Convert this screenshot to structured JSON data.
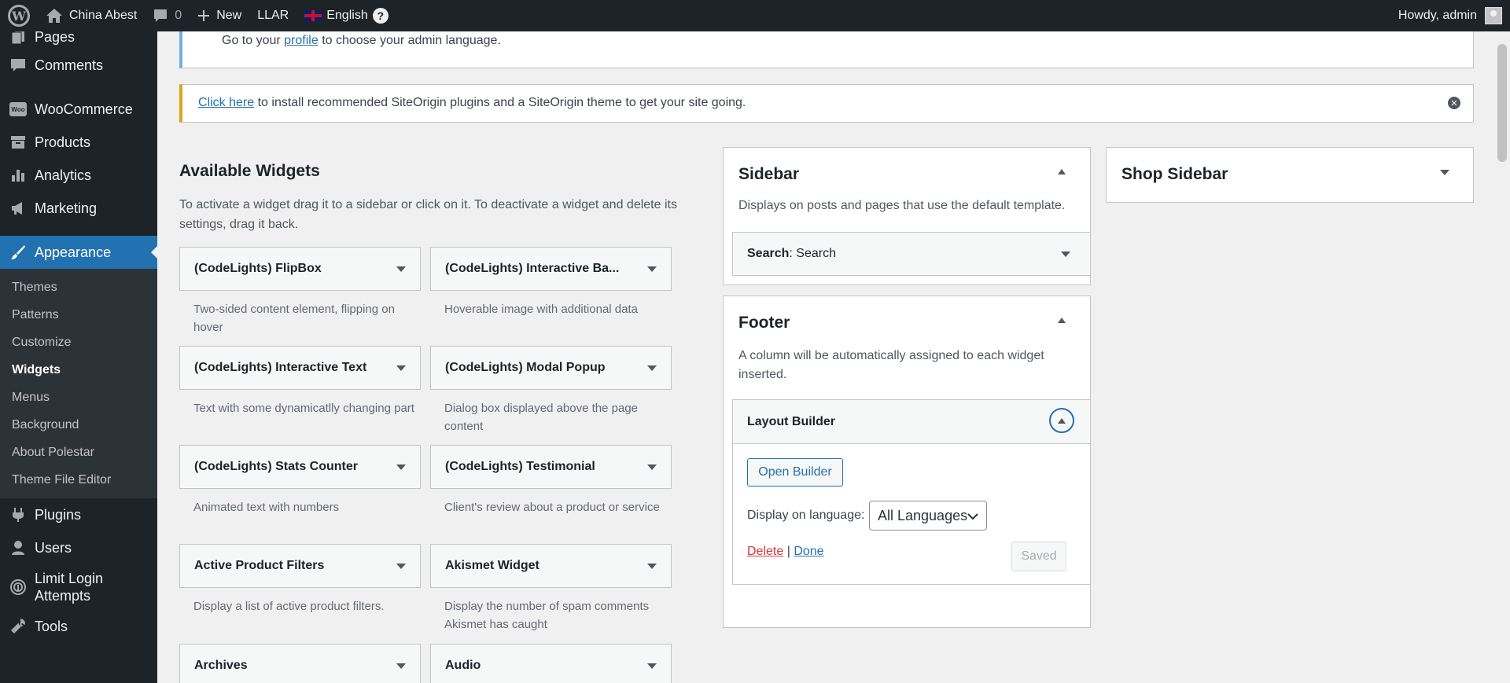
{
  "adminbar": {
    "site_name": "China Abest",
    "comments_count": "0",
    "new_label": "New",
    "llar_label": "LLAR",
    "language_label": "English",
    "help_label": "?",
    "howdy": "Howdy, admin"
  },
  "menu": {
    "pages": "Pages",
    "comments": "Comments",
    "woocommerce": "WooCommerce",
    "woo_badge": "Woo",
    "products": "Products",
    "analytics": "Analytics",
    "marketing": "Marketing",
    "appearance": "Appearance",
    "sub": [
      "Themes",
      "Patterns",
      "Customize",
      "Widgets",
      "Menus",
      "Background",
      "About Polestar",
      "Theme File Editor"
    ],
    "plugins": "Plugins",
    "users": "Users",
    "limit_login_1": "Limit Login",
    "limit_login_2": "Attempts",
    "tools": "Tools"
  },
  "notices": {
    "lang_pre": "Go to your",
    "lang_link": "profile",
    "lang_post": "to choose your admin language.",
    "so_link": "Click here",
    "so_text": "to install recommended SiteOrigin plugins and a SiteOrigin theme to get your site going."
  },
  "available": {
    "title": "Available Widgets",
    "desc": "To activate a widget drag it to a sidebar or click on it. To deactivate a widget and delete its settings, drag it back.",
    "widgets": [
      {
        "name": "(CodeLights) FlipBox",
        "desc": "Two-sided content element, flipping on hover"
      },
      {
        "name": "(CodeLights) Interactive Ba...",
        "desc": "Hoverable image with additional data"
      },
      {
        "name": "(CodeLights) Interactive Text",
        "desc": "Text with some dynamicatlly changing part"
      },
      {
        "name": "(CodeLights) Modal Popup",
        "desc": "Dialog box displayed above the page content"
      },
      {
        "name": "(CodeLights) Stats Counter",
        "desc": "Animated text with numbers"
      },
      {
        "name": "(CodeLights) Testimonial",
        "desc": "Client's review about a product or service"
      },
      {
        "name": "Active Product Filters",
        "desc": "Display a list of active product filters."
      },
      {
        "name": "Akismet Widget",
        "desc": "Display the number of spam comments Akismet has caught"
      },
      {
        "name": "Archives",
        "desc": ""
      },
      {
        "name": "Audio",
        "desc": ""
      }
    ]
  },
  "sidebar_area": {
    "title": "Sidebar",
    "desc": "Displays on posts and pages that use the default template.",
    "widget_bold": "Search",
    "widget_rest": ": Search"
  },
  "footer_area": {
    "title": "Footer",
    "desc": "A column will be automatically assigned to each widget inserted.",
    "widget_title": "Layout Builder",
    "open_builder": "Open Builder",
    "display_lang_label": "Display on language:",
    "lang_value": "All Languages",
    "delete": "Delete",
    "sep": "|",
    "done": "Done",
    "saved": "Saved"
  },
  "shop_sidebar": {
    "title": "Shop Sidebar"
  }
}
